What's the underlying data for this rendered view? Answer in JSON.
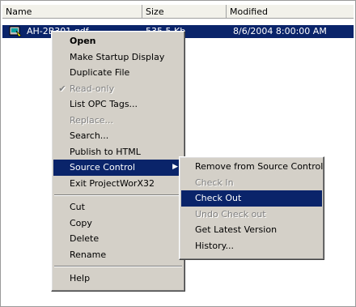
{
  "columns": {
    "name": "Name",
    "size": "Size",
    "modified": "Modified"
  },
  "file": {
    "name": "AH-2B301.gdf",
    "size": "535.5 Kb",
    "modified": "8/6/2004 8:00:00 AM"
  },
  "context_menu": {
    "open": "Open",
    "make_startup_display": "Make Startup Display",
    "duplicate_file": "Duplicate File",
    "read_only": "Read-only",
    "list_opc_tags": "List OPC Tags...",
    "replace": "Replace...",
    "search": "Search...",
    "publish_html": "Publish to HTML",
    "source_control": "Source Control",
    "exit": "Exit ProjectWorX32",
    "cut": "Cut",
    "copy": "Copy",
    "delete": "Delete",
    "rename": "Rename",
    "help": "Help"
  },
  "submenu": {
    "remove": "Remove from Source Control",
    "check_in": "Check In",
    "check_out": "Check Out",
    "undo_check_out": "Undo Check out",
    "get_latest": "Get Latest Version",
    "history": "History..."
  },
  "colors": {
    "highlight": "#0a246a",
    "menu_bg": "#d4d0c8",
    "disabled": "#808080"
  }
}
